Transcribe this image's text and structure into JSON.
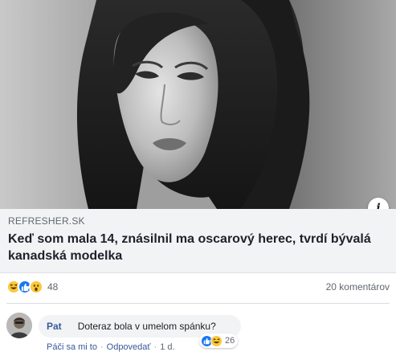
{
  "post": {
    "image": {
      "alt_icon": "portrait-photo"
    },
    "link": {
      "source": "REFRESHER.SK",
      "headline": "Keď som mala 14, znásilnil ma oscarový herec, tvrdí bývalá kanadská modelka"
    },
    "info_icon": "i"
  },
  "reactions": {
    "types": [
      "haha",
      "like",
      "wow"
    ],
    "count": "48",
    "comments_label": "20 komentárov"
  },
  "comment": {
    "author": "Pat",
    "text": "Doteraz bola v umelom spánku?",
    "reactions": {
      "types": [
        "like",
        "haha"
      ],
      "count": "26"
    },
    "actions": {
      "like": "Páči sa mi to",
      "reply": "Odpovedať",
      "time": "1 d."
    }
  },
  "colors": {
    "link_card_bg": "#f2f3f5",
    "like_blue": "#1877f2",
    "emoji_yellow": "#fbc93d",
    "author_blue": "#385898"
  }
}
